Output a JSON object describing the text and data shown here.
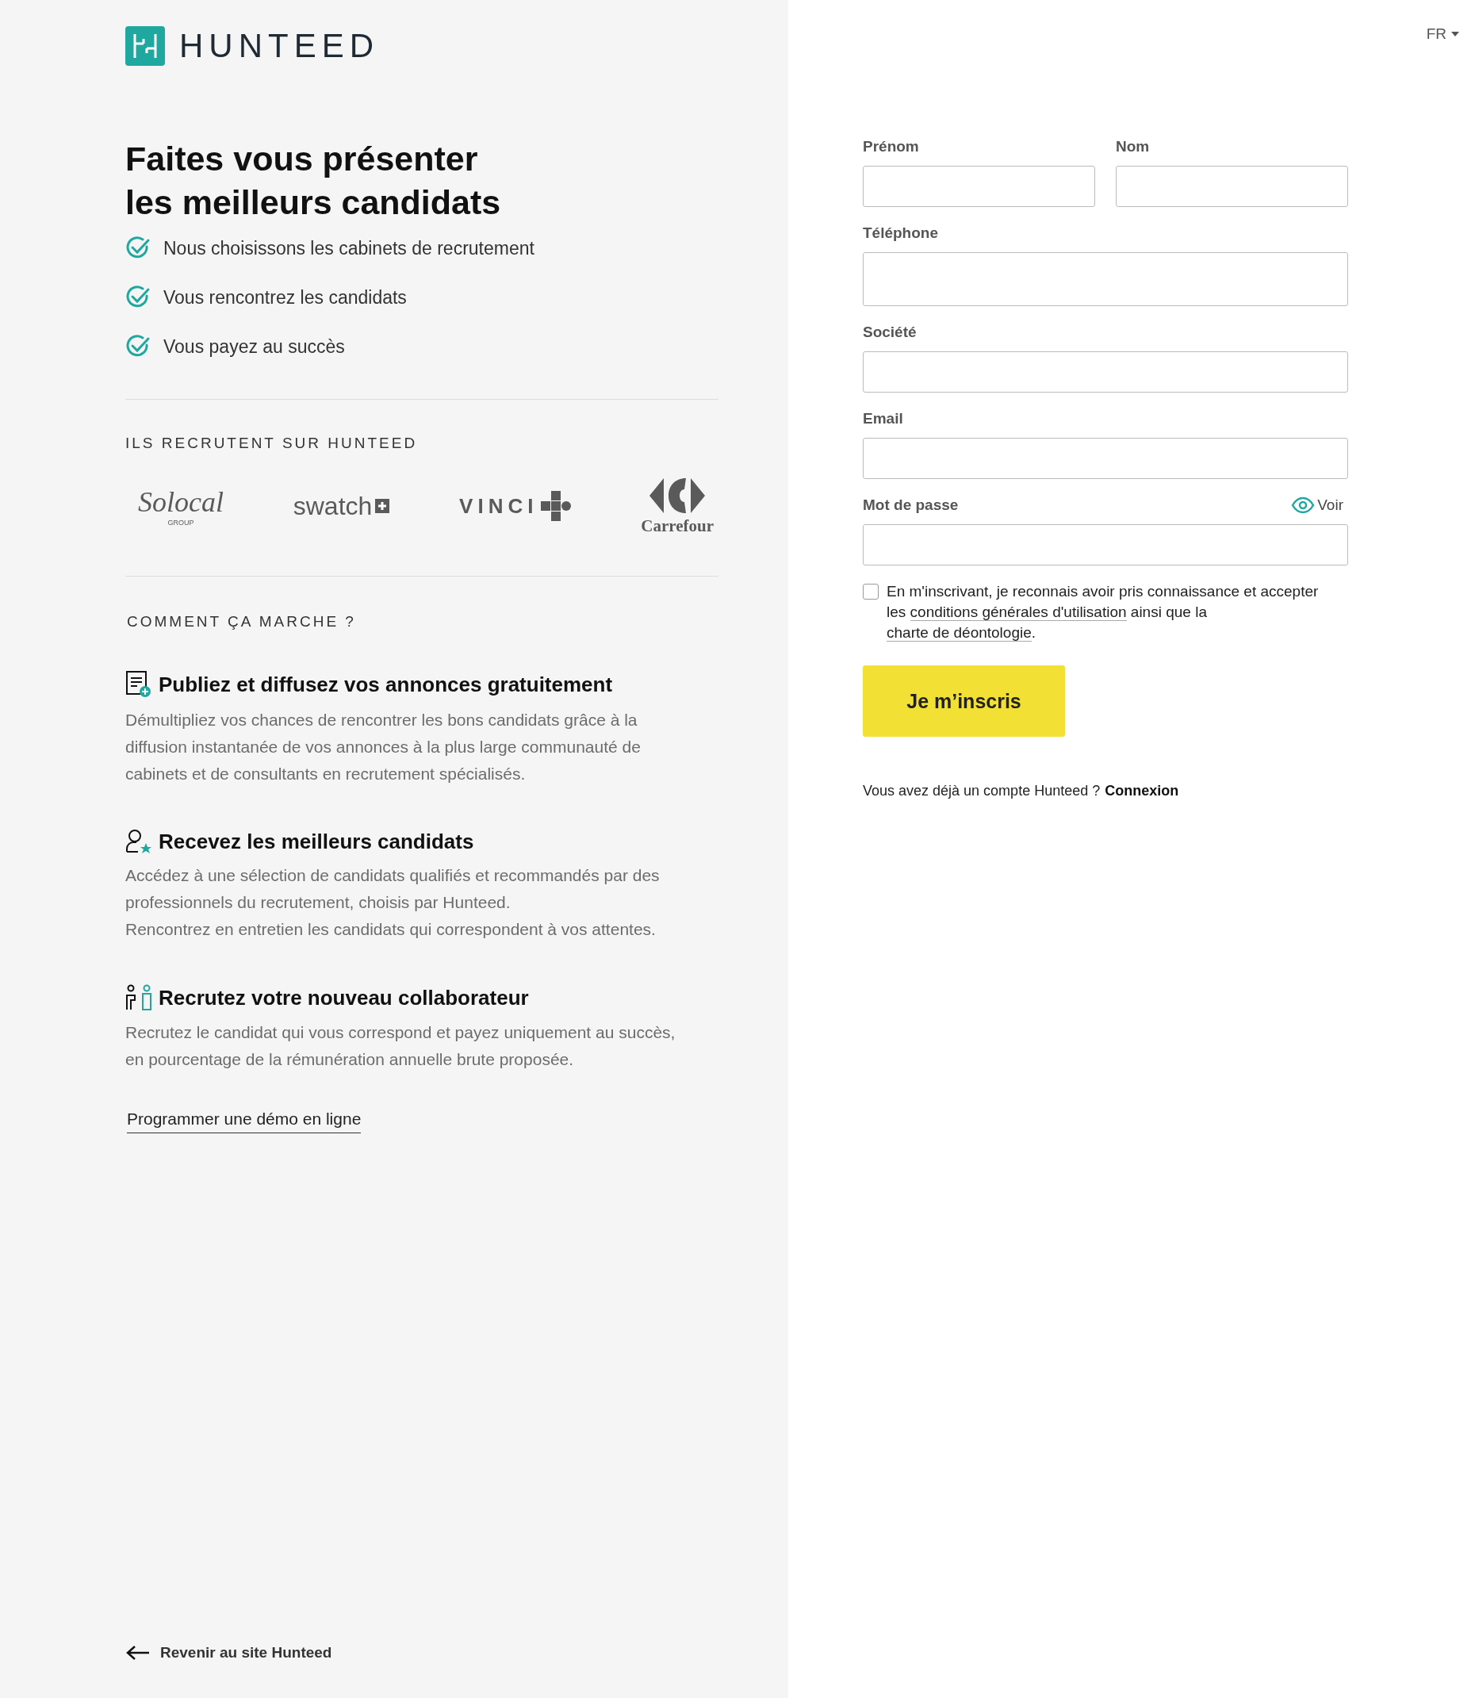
{
  "brand": {
    "name": "HUNTEED"
  },
  "language": {
    "label": "FR"
  },
  "headline": [
    "Faites vous présenter",
    "les meilleurs candidats"
  ],
  "benefits": [
    "Nous choisissons les cabinets de recrutement",
    "Vous rencontrez les candidats",
    "Vous payez au succès"
  ],
  "clients": {
    "title": "ILS RECRUTENT SUR HUNTEED",
    "logos": [
      {
        "kind": "script",
        "text": "Solocal",
        "subtext": "GROUP"
      },
      {
        "kind": "plus",
        "text": "swatch"
      },
      {
        "kind": "cross",
        "text": "VINCI"
      },
      {
        "kind": "emblem",
        "text": "Carrefour"
      }
    ]
  },
  "how_it_works": {
    "title": "COMMENT ÇA MARCHE ?",
    "steps": [
      {
        "kind": "document",
        "title": "Publiez et diffusez vos annonces gratuitement",
        "paragraphs": [
          "Démultipliez vos chances de rencontrer les bons candidats grâce à la diffusion instantanée de vos annonces à la plus large communauté de cabinets et de consultants en recrutement spécialisés."
        ]
      },
      {
        "kind": "person",
        "title": "Recevez les meilleurs candidats",
        "paragraphs": [
          "Accédez à une sélection de candidats qualifiés et recommandés par des professionnels du recrutement, choisis par Hunteed.",
          "Rencontrez en entretien les candidats qui correspondent à vos attentes."
        ]
      },
      {
        "kind": "pair",
        "title": "Recrutez votre nouveau collaborateur",
        "paragraphs": [
          "Recrutez le candidat qui vous correspond et payez uniquement au succès, en pourcentage de la rémunération annuelle brute proposée."
        ]
      }
    ],
    "demo_link": "Programmer une démo en ligne"
  },
  "back_link": "Revenir au site Hunteed",
  "form": {
    "rows": [
      [
        {
          "label": "Prénom",
          "kind": "text"
        },
        {
          "label": "Nom",
          "kind": "text"
        }
      ],
      [
        {
          "label": "Téléphone",
          "kind": "tall"
        }
      ],
      [
        {
          "label": "Société",
          "kind": "text"
        }
      ],
      [
        {
          "label": "Email",
          "kind": "text"
        }
      ],
      [
        {
          "label": "Mot de passe",
          "kind": "password",
          "reveal": "Voir"
        }
      ]
    ],
    "consent": {
      "checked": false,
      "parts": [
        {
          "text": "En m'inscrivant, je reconnais avoir pris connaissance et accepter les ",
          "link": false
        },
        {
          "text": "conditions générales d'utilisation",
          "link": true
        },
        {
          "text": " ainsi que la ",
          "link": false
        },
        {
          "text": "charte de déontologie",
          "link": true
        },
        {
          "text": ".",
          "link": false
        }
      ]
    },
    "submit": "Je m’inscris",
    "login_prompt": "Vous avez déjà un compte Hunteed ?",
    "login_link": "Connexion"
  }
}
